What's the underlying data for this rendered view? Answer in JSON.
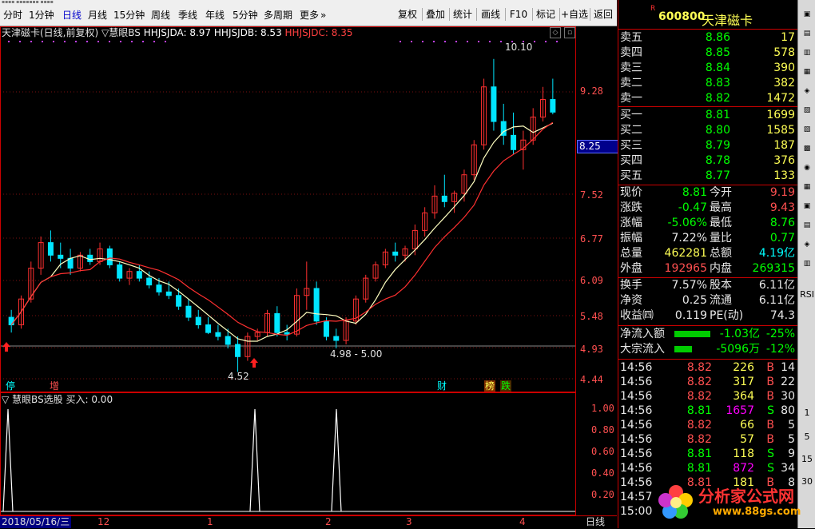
{
  "toolbar": {
    "periods": [
      "分时",
      "1分钟",
      "日线",
      "月线",
      "15分钟",
      "周线",
      "季线",
      "年线",
      "5分钟",
      "多周期",
      "更多"
    ],
    "more_arrow": "»",
    "active_period": "日线",
    "buttons": [
      "复权",
      "叠加",
      "统计",
      "画线",
      "F10",
      "标记",
      "+自选",
      "返回"
    ]
  },
  "chart": {
    "stock_name": "天津磁卡(日线,前复权)",
    "indicator_marker": "▽",
    "indicator_name": "慧眼BS",
    "hhjsjda": "HHJSJDA: 8.97",
    "hhjsjdb": "HHJSJDB: 8.53",
    "hhjsjdc": "HHJSJDC: 8.35",
    "y_labels": [
      "9.28",
      "8.25",
      "7.52",
      "6.77",
      "6.09",
      "5.48",
      "4.93",
      "4.44"
    ],
    "current_price_tag": "8.25",
    "annot_high": "10.10",
    "annot_low": "4.52",
    "annot_range": "4.98 - 5.00",
    "marks": [
      {
        "text": "停",
        "color": "#00ffff"
      },
      {
        "text": "增",
        "color": "#ff5050"
      },
      {
        "text": "财",
        "color": "#00ffff"
      },
      {
        "text": "榜",
        "color": "#ffff55",
        "bg": "#7f3000"
      },
      {
        "text": "跌",
        "color": "#00ff00",
        "bg": "#4a2a00"
      }
    ]
  },
  "indicator": {
    "header": "▽ 慧眼BS选股  买入: 0.00",
    "y_labels": [
      "1.00",
      "0.80",
      "0.60",
      "0.40",
      "0.20"
    ]
  },
  "xaxis": {
    "date": "2018/05/16/三",
    "ticks": [
      "12",
      "1",
      "2",
      "3",
      "4"
    ],
    "period": "日线"
  },
  "quote": {
    "r_mark": "R",
    "code": "600800",
    "name": "天津磁卡",
    "asks": [
      {
        "label": "卖五",
        "price": "8.86",
        "vol": "17"
      },
      {
        "label": "卖四",
        "price": "8.85",
        "vol": "578"
      },
      {
        "label": "卖三",
        "price": "8.84",
        "vol": "390"
      },
      {
        "label": "卖二",
        "price": "8.83",
        "vol": "382"
      },
      {
        "label": "卖一",
        "price": "8.82",
        "vol": "1472"
      }
    ],
    "bids": [
      {
        "label": "买一",
        "price": "8.81",
        "vol": "1699"
      },
      {
        "label": "买二",
        "price": "8.80",
        "vol": "1585"
      },
      {
        "label": "买三",
        "price": "8.79",
        "vol": "187"
      },
      {
        "label": "买四",
        "price": "8.78",
        "vol": "376"
      },
      {
        "label": "买五",
        "price": "8.77",
        "vol": "133"
      }
    ],
    "stats": [
      {
        "l1": "现价",
        "v1": "8.81",
        "c1": "grn",
        "l2": "今开",
        "v2": "9.19",
        "c2": "red"
      },
      {
        "l1": "涨跌",
        "v1": "-0.47",
        "c1": "grn",
        "l2": "最高",
        "v2": "9.43",
        "c2": "red"
      },
      {
        "l1": "涨幅",
        "v1": "-5.06%",
        "c1": "grn",
        "l2": "最低",
        "v2": "8.76",
        "c2": "grn"
      },
      {
        "l1": "振幅",
        "v1": "7.22%",
        "c1": "wht",
        "l2": "量比",
        "v2": "0.77",
        "c2": "grn"
      },
      {
        "l1": "总量",
        "v1": "462281",
        "c1": "yel",
        "l2": "总额",
        "v2": "4.19亿",
        "c2": "cyn"
      },
      {
        "l1": "外盘",
        "v1": "192965",
        "c1": "red",
        "l2": "内盘",
        "v2": "269315",
        "c2": "grn"
      }
    ],
    "stats2": [
      {
        "l1": "换手",
        "v1": "7.57%",
        "c1": "wht",
        "l2": "股本",
        "v2": "6.11亿",
        "c2": "wht"
      },
      {
        "l1": "净资",
        "v1": "0.25",
        "c1": "wht",
        "l2": "流通",
        "v2": "6.11亿",
        "c2": "wht"
      },
      {
        "l1": "收益㈣",
        "v1": "0.119",
        "c1": "wht",
        "l2": "PE(动)",
        "v2": "74.3",
        "c2": "wht"
      }
    ],
    "flows": [
      {
        "label": "净流入额",
        "value": "-1.03亿",
        "pct": "-25%",
        "bar": 0.25
      },
      {
        "label": "大宗流入",
        "value": "-5096万",
        "pct": "-12%",
        "bar": 0.12
      }
    ],
    "ticks": [
      {
        "time": "14:56",
        "price": "8.82",
        "vol": "226",
        "side": "B",
        "n": "14",
        "pc": "red",
        "vc": "yel"
      },
      {
        "time": "14:56",
        "price": "8.82",
        "vol": "317",
        "side": "B",
        "n": "22",
        "pc": "red",
        "vc": "yel"
      },
      {
        "time": "14:56",
        "price": "8.82",
        "vol": "364",
        "side": "B",
        "n": "30",
        "pc": "red",
        "vc": "yel"
      },
      {
        "time": "14:56",
        "price": "8.81",
        "vol": "1657",
        "side": "S",
        "n": "80",
        "pc": "grn",
        "vc": "mag"
      },
      {
        "time": "14:56",
        "price": "8.82",
        "vol": "66",
        "side": "B",
        "n": "5",
        "pc": "red",
        "vc": "yel"
      },
      {
        "time": "14:56",
        "price": "8.82",
        "vol": "57",
        "side": "B",
        "n": "5",
        "pc": "red",
        "vc": "yel"
      },
      {
        "time": "14:56",
        "price": "8.81",
        "vol": "118",
        "side": "S",
        "n": "9",
        "pc": "grn",
        "vc": "yel"
      },
      {
        "time": "14:56",
        "price": "8.81",
        "vol": "872",
        "side": "S",
        "n": "34",
        "pc": "grn",
        "vc": "mag"
      },
      {
        "time": "14:56",
        "price": "8.81",
        "vol": "181",
        "side": "B",
        "n": "8",
        "pc": "red",
        "vc": "yel"
      },
      {
        "time": "14:57",
        "price": "",
        "vol": "",
        "side": "",
        "n": "",
        "pc": "red",
        "vc": "yel"
      },
      {
        "time": "15:00",
        "price": "",
        "vol": "",
        "side": "",
        "n": "",
        "pc": "red",
        "vc": "yel"
      }
    ]
  },
  "sidebar": {
    "labels": [
      "RSI",
      "1",
      "5",
      "15",
      "30"
    ]
  },
  "watermark": {
    "title": "分析家公式网",
    "url": "www.88gs.com"
  }
}
